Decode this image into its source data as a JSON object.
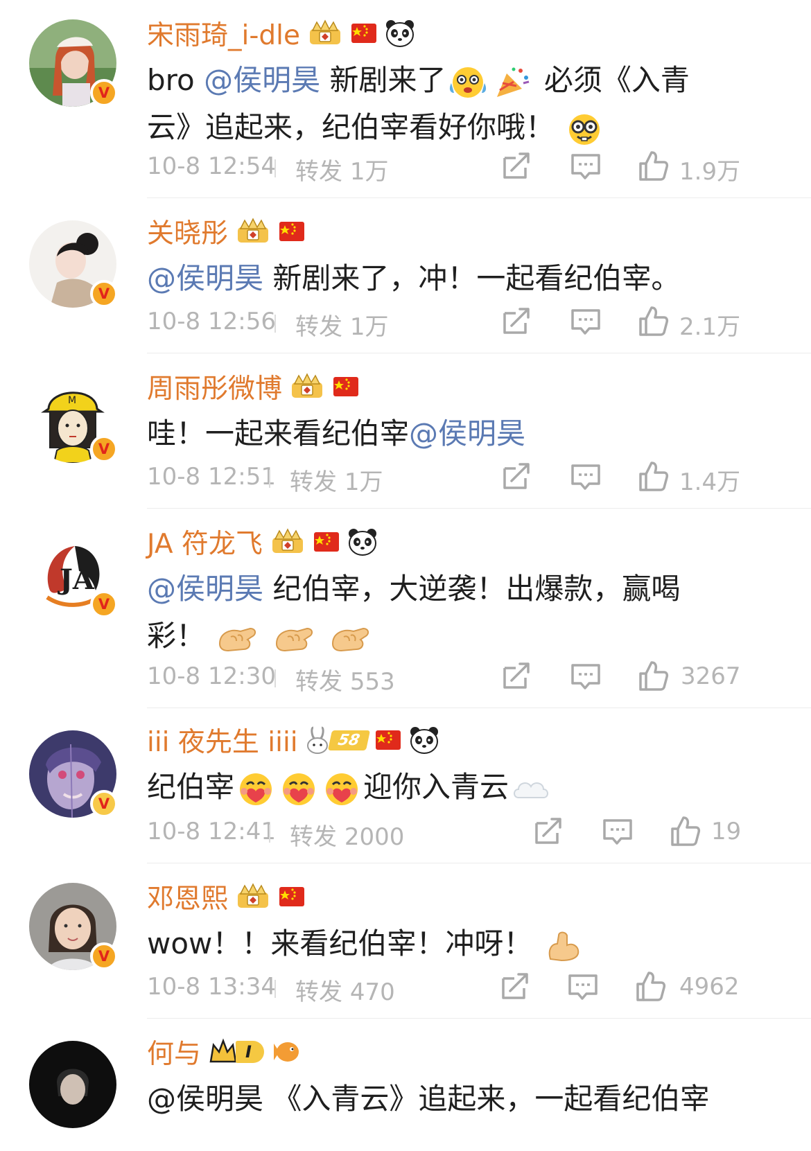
{
  "comments": [
    {
      "username": "宋雨琦_i-dle",
      "text_prefix": "bro",
      "mention": "@侯明昊",
      "text_mid": "新剧来了",
      "text_after": "必须《入青",
      "text_line2": "云》追起来，纪伯宰看好你哦！",
      "time": "10-8 12:54",
      "repost_label": "转发",
      "repost_count": "1万",
      "likes": "1.9万"
    },
    {
      "username": "关晓彤",
      "mention": "@侯明昊",
      "text": "新剧来了，冲！一起看纪伯宰。",
      "time": "10-8 12:56",
      "repost_label": "转发",
      "repost_count": "1万",
      "likes": "2.1万"
    },
    {
      "username": "周雨彤微博",
      "text": "哇！一起来看纪伯宰",
      "mention": "@侯明昊",
      "time": "10-8 12:51",
      "repost_label": "转发",
      "repost_count": "1万",
      "likes": "1.4万"
    },
    {
      "username": "JA 符龙飞",
      "mention": "@侯明昊",
      "text": "纪伯宰，大逆袭！出爆款，赢喝",
      "text_line2": "彩！",
      "time": "10-8 12:30",
      "repost_label": "转发",
      "repost_count": "553",
      "likes": "3267"
    },
    {
      "username": "iii 夜先生 iiii",
      "level_badge": "58",
      "text_prefix": "纪伯宰",
      "text_after": "迎你入青云",
      "time": "10-8 12:41",
      "repost_label": "转发",
      "repost_count": "2000",
      "likes": "19"
    },
    {
      "username": "邓恩熙",
      "text": "wow！！来看纪伯宰！冲呀！",
      "time": "10-8 13:34",
      "repost_label": "转发",
      "repost_count": "470",
      "likes": "4962"
    },
    {
      "username": "何与",
      "level_badge": "I",
      "partial_text": "@侯明昊 《入青云》追起来，一起看纪伯宰"
    }
  ],
  "colors": {
    "username": "#e07a2e",
    "mention": "#5b7ab3",
    "meta": "#b5b5b5",
    "verified": "#f5a623"
  }
}
